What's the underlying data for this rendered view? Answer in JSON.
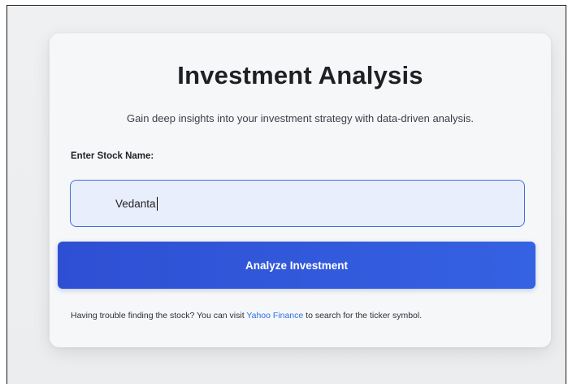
{
  "page": {
    "title": "Investment Analysis",
    "subtitle": "Gain deep insights into your investment strategy with data-driven analysis."
  },
  "form": {
    "stock_label": "Enter Stock Name:",
    "stock_value": "Vedanta",
    "submit_label": "Analyze Investment"
  },
  "help": {
    "prefix": "Having trouble finding the stock? You can visit ",
    "link_text": "Yahoo Finance",
    "suffix": " to search for the ticker symbol."
  },
  "colors": {
    "accent": "#3462e2",
    "link": "#2f6fe0",
    "input_border": "#3f6fdc",
    "input_bg": "#e9eefc"
  }
}
